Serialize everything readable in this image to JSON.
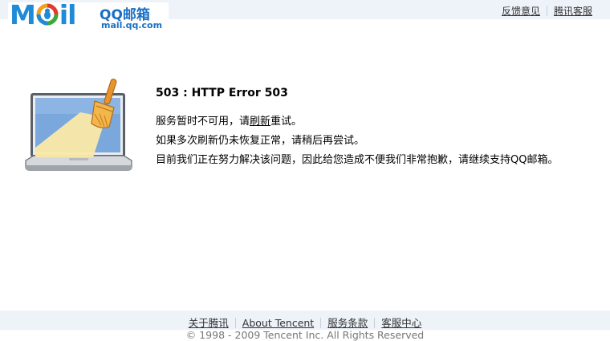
{
  "header": {
    "logo_letters": [
      "M",
      "o",
      "i",
      "l"
    ],
    "logo_cn": "QQ邮箱",
    "logo_url": "mail.qq.com",
    "links": [
      {
        "label": "反馈意见"
      },
      {
        "label": "腾讯客服"
      }
    ]
  },
  "error": {
    "title": "503 : HTTP Error 503",
    "line1_prefix": "服务暂时不可用，请",
    "line1_link": "刷新",
    "line1_suffix": "重试。",
    "line2": "如果多次刷新仍未恢复正常，请稍后再尝试。",
    "line3": "目前我们正在努力解决该问题，因此给您造成不便我们非常抱歉，请继续支持QQ邮箱。"
  },
  "footer": {
    "links": [
      {
        "label": "关于腾讯"
      },
      {
        "label": "About Tencent"
      },
      {
        "label": "服务条款"
      },
      {
        "label": "客服中心"
      }
    ],
    "copyright": "© 1998 - 2009 Tencent Inc. All Rights Reserved"
  },
  "colors": {
    "bar_bg": "#eef3fa",
    "logo_blue": "#1f8ad6",
    "screen_blue": "#7aa7dc",
    "broom_orange": "#e8942a"
  }
}
